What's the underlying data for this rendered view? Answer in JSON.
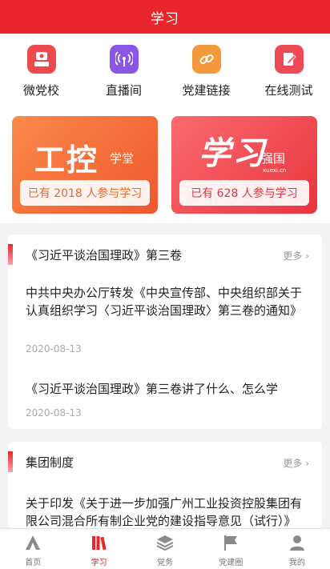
{
  "header": {
    "title": "学习"
  },
  "quick_links": [
    {
      "label": "微党校",
      "icon": "school-icon",
      "color": "#ec4a4f"
    },
    {
      "label": "直播间",
      "icon": "live-broadcast-icon",
      "color": "#8b55e6"
    },
    {
      "label": "党建链接",
      "icon": "link-icon",
      "color": "#f29a3c"
    },
    {
      "label": "在线测试",
      "icon": "edit-test-icon",
      "color": "#ee4a56"
    }
  ],
  "banners": [
    {
      "title": "工控",
      "subtitle": "学堂",
      "stat": "已有 2018 人参与学习"
    },
    {
      "title": "学习",
      "subtitle": "强国",
      "small": "xuexi.cn",
      "stat": "已有 628 人参与学习"
    }
  ],
  "sections": [
    {
      "title": "《习近平谈治国理政》第三卷",
      "more": "更多",
      "items": [
        {
          "title": "中共中央办公厅转发《中央宣传部、中央组织部关于认真组织学习〈习近平谈治国理政〉第三卷的通知》",
          "date": "2020-08-13"
        },
        {
          "title": "《习近平谈治国理政》第三卷讲了什么、怎么学",
          "date": "2020-08-13"
        }
      ]
    },
    {
      "title": "集团制度",
      "more": "更多",
      "items": [
        {
          "title": "关于印发《关于进一步加强广州工业投资控股集团有限公司混合所有制企业党的建设指导意见（试行）》的通知"
        }
      ]
    }
  ],
  "tabbar": [
    {
      "label": "首页",
      "icon": "home-icon",
      "active": false
    },
    {
      "label": "学习",
      "icon": "books-icon",
      "active": true
    },
    {
      "label": "党务",
      "icon": "layers-icon",
      "active": false
    },
    {
      "label": "党建圈",
      "icon": "flag-icon",
      "active": false
    },
    {
      "label": "我的",
      "icon": "user-icon",
      "active": false
    }
  ],
  "colors": {
    "primary": "#e8262b"
  }
}
